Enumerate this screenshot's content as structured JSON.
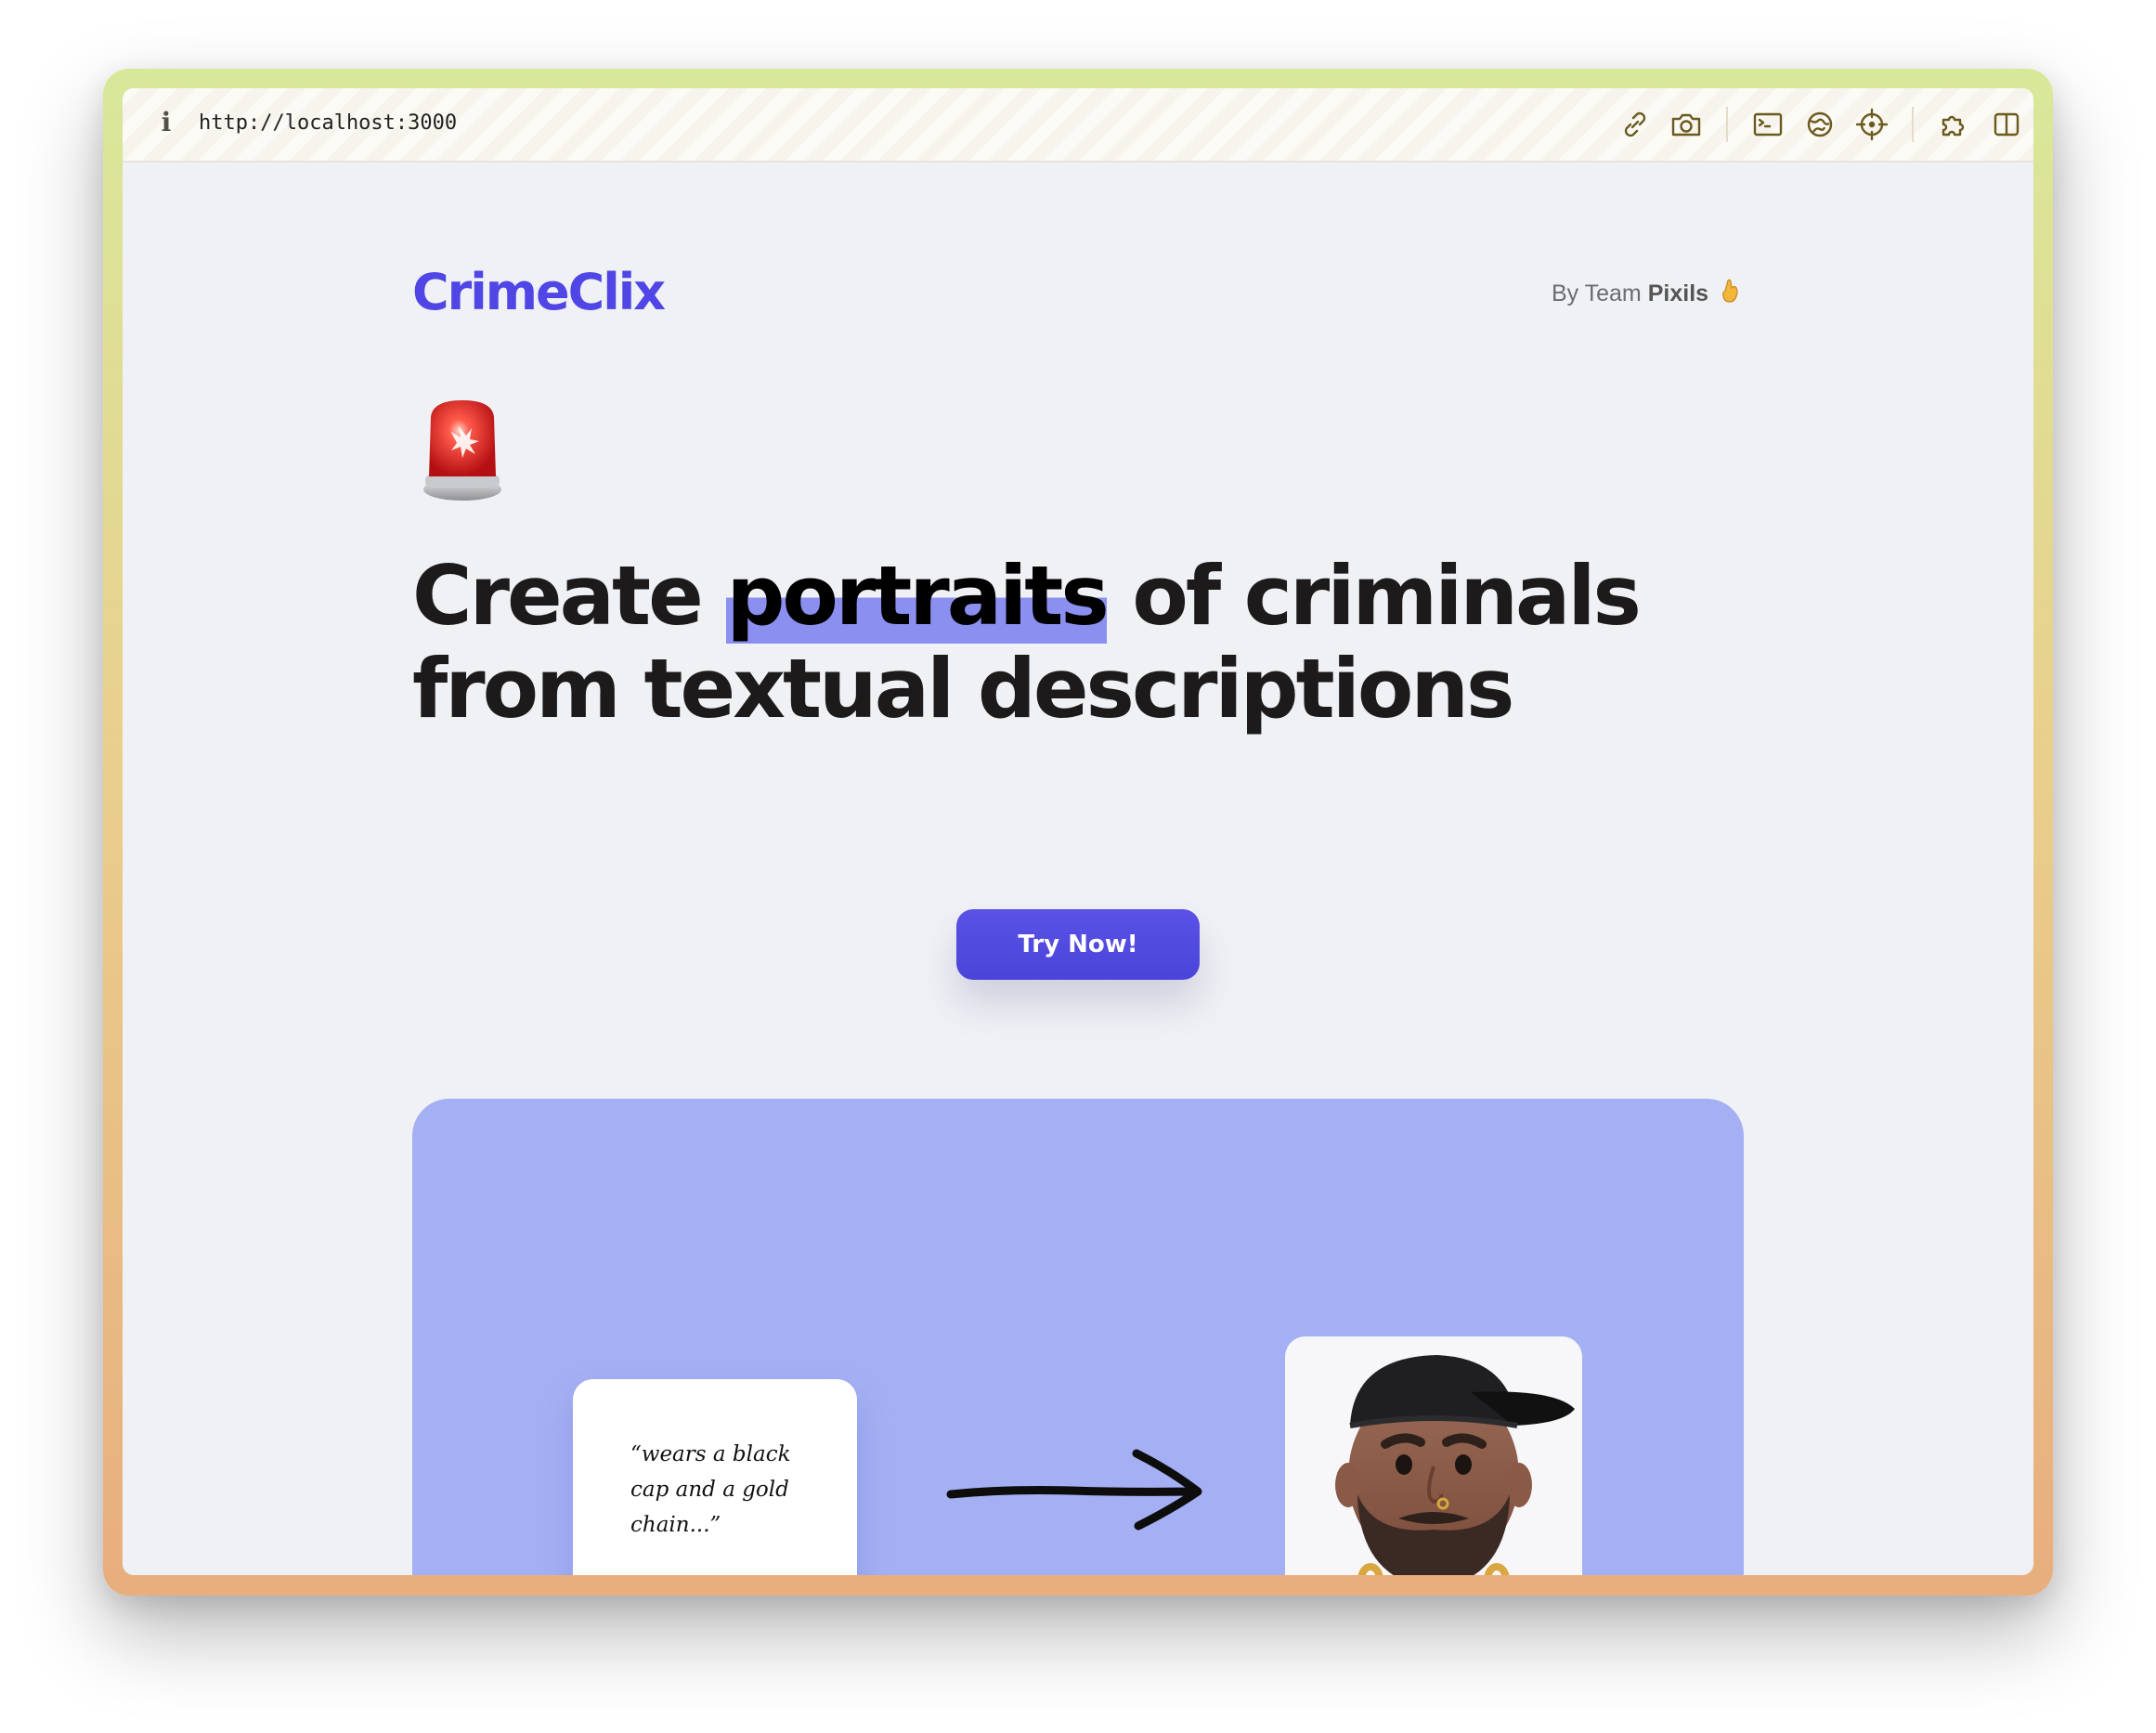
{
  "browser": {
    "url": "http://localhost:3000",
    "info_icon": "i",
    "toolbar_icons": [
      "link-icon",
      "camera-icon",
      "terminal-icon",
      "globe-icon",
      "crosshair-icon",
      "puzzle-icon",
      "split-view-icon"
    ]
  },
  "header": {
    "brand": "CrimeClix",
    "byline_prefix": "By Team",
    "byline_team": "Pixils",
    "byline_emoji": "hand-emoji"
  },
  "hero": {
    "emoji": "siren-emoji",
    "headline_pre": "Create ",
    "headline_highlight": "portraits",
    "headline_post": " of criminals",
    "headline_line2": "from textual descriptions",
    "cta_label": "Try Now!"
  },
  "showcase": {
    "quote": "“wears a black cap and a gold chain...”",
    "arrow_icon": "arrow-right-icon",
    "portrait_image": "generated-portrait-avatar"
  },
  "colors": {
    "brand": "#4f46e5",
    "highlight": "#8b8ff0",
    "showcase_bg": "#a5b0f4",
    "page_bg": "#f0f1f5"
  }
}
